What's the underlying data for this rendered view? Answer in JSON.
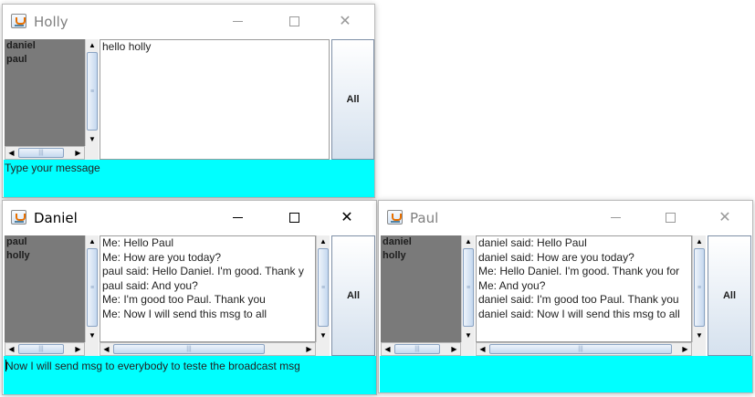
{
  "windows": {
    "holly": {
      "title": "Holly",
      "users": [
        "daniel",
        "paul"
      ],
      "messages": [
        "hello holly"
      ],
      "all_button": "All",
      "input_text": "Type your message"
    },
    "daniel": {
      "title": "Daniel",
      "users": [
        "paul",
        "holly"
      ],
      "messages": [
        "Me: Hello Paul",
        "Me: How are you today?",
        "paul said: Hello Daniel.  I'm good.  Thank y",
        "paul said: And you?",
        "Me: I'm good too Paul.  Thank you",
        "Me: Now I will send this msg to all"
      ],
      "all_button": "All",
      "input_text": "Now I will send msg to everybody to teste the broadcast msg"
    },
    "paul": {
      "title": "Paul",
      "users": [
        "daniel",
        "holly"
      ],
      "messages": [
        "daniel said: Hello Paul",
        "daniel said: How are you today?",
        "Me: Hello Daniel.  I'm good.  Thank you for",
        "Me: And you?",
        "daniel said: I'm good too Paul.  Thank you",
        "daniel said: Now I will send this msg to all"
      ],
      "all_button": "All",
      "input_text": ""
    }
  },
  "icons": {
    "app": "java-app-icon",
    "minimize": "minimize-icon",
    "maximize": "maximize-icon",
    "close": "close-icon",
    "scroll_up": "▲",
    "scroll_down": "▼",
    "scroll_left": "◀",
    "scroll_right": "▶",
    "close_glyph": "✕"
  },
  "colors": {
    "input_background": "#00ffff",
    "user_list_background": "#7a7a7a"
  }
}
